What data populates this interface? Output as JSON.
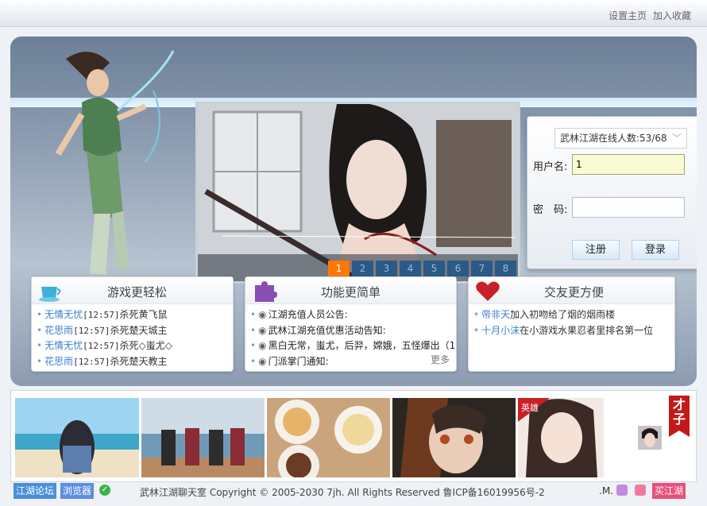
{
  "header": {
    "links": [
      "设置主页",
      "加入收藏"
    ]
  },
  "slideshow": {
    "pages": [
      "1",
      "2",
      "3",
      "4",
      "5",
      "6",
      "7",
      "8"
    ],
    "active": "1"
  },
  "login": {
    "online_label": "武林江湖在线人数:53/68",
    "username_label": "用户名:",
    "username_value": "1",
    "password_label": "密　码:",
    "register_label": "注册",
    "login_label": "登录"
  },
  "boxes": {
    "game": {
      "title": "游戏更轻松",
      "items": [
        {
          "name": "无情无忧",
          "time": "[12:57]",
          "text": "杀死黄飞鼠"
        },
        {
          "name": "花思雨",
          "time": "[12:57]",
          "text": "杀死楚天城主"
        },
        {
          "name": "无情无忧",
          "time": "[12:57]",
          "text": "杀死◇蚩尤◇"
        },
        {
          "name": "花思雨",
          "time": "[12:57]",
          "text": "杀死楚天教主"
        }
      ]
    },
    "func": {
      "title": "功能更简单",
      "items": [
        "江湖充值人员公告:",
        "武林江湖充值优惠活动告知:",
        "黑白无常，蚩尤，后羿，嫦娥，五怪爆出（1",
        "门派掌门通知:"
      ],
      "more": "更多"
    },
    "social": {
      "title": "交友更方便",
      "items": [
        {
          "name": "帝非天",
          "text": "加入初吻给了烟的烟雨楼"
        },
        {
          "name": "十月小沫",
          "text": "在小游戏水果忍者里排名第一位"
        }
      ]
    }
  },
  "gallery": {
    "ribbon": "才子",
    "badge": "英雄"
  },
  "footer": {
    "forum": "江湖论坛",
    "browser": "浏览器",
    "copyright": "武林江湖聊天室 Copyright © 2005-2030 7jh. All Rights Reserved 鲁ICP备16019956号-2",
    "dotm": ".M.",
    "buy": "买江湖"
  },
  "colors": {
    "link": "#3b7ed1",
    "active_page": "#ff7800",
    "buy": "#e8507a"
  }
}
